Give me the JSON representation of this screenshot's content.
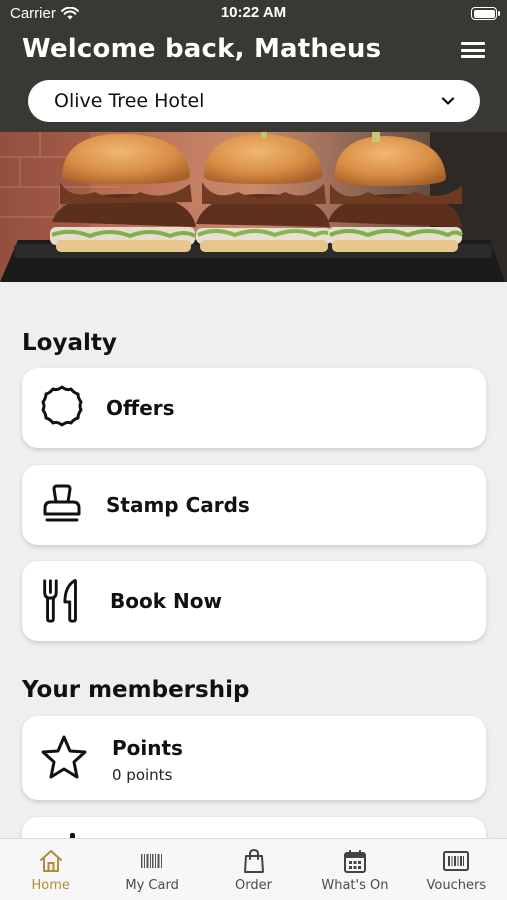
{
  "status_bar": {
    "carrier": "Carrier",
    "time": "10:22 AM"
  },
  "header": {
    "title": "Welcome back, Matheus",
    "menu_icon": "hamburger-menu-icon"
  },
  "venue_select": {
    "value": "Olive Tree Hotel",
    "icon": "chevron-down-icon"
  },
  "hero": {
    "image": "burger-sliders-photo"
  },
  "loyalty": {
    "title": "Loyalty",
    "items": [
      {
        "label": "Offers",
        "icon": "badge-icon"
      },
      {
        "label": "Stamp Cards",
        "icon": "stamp-icon"
      },
      {
        "label": "Book Now",
        "icon": "fork-knife-icon"
      }
    ]
  },
  "membership": {
    "title": "Your membership",
    "points": {
      "label": "Points",
      "value": "0 points",
      "icon": "star-icon"
    }
  },
  "tabbar": {
    "items": [
      {
        "label": "Home",
        "icon": "home-icon",
        "active": true
      },
      {
        "label": "My Card",
        "icon": "barcode-icon",
        "active": false
      },
      {
        "label": "Order",
        "icon": "shopping-bag-icon",
        "active": false
      },
      {
        "label": "What's On",
        "icon": "calendar-icon",
        "active": false
      },
      {
        "label": "Vouchers",
        "icon": "voucher-barcode-icon",
        "active": false
      }
    ]
  },
  "colors": {
    "header_bg": "#3a3833",
    "accent": "#b5893a",
    "page_bg": "#efefef"
  }
}
